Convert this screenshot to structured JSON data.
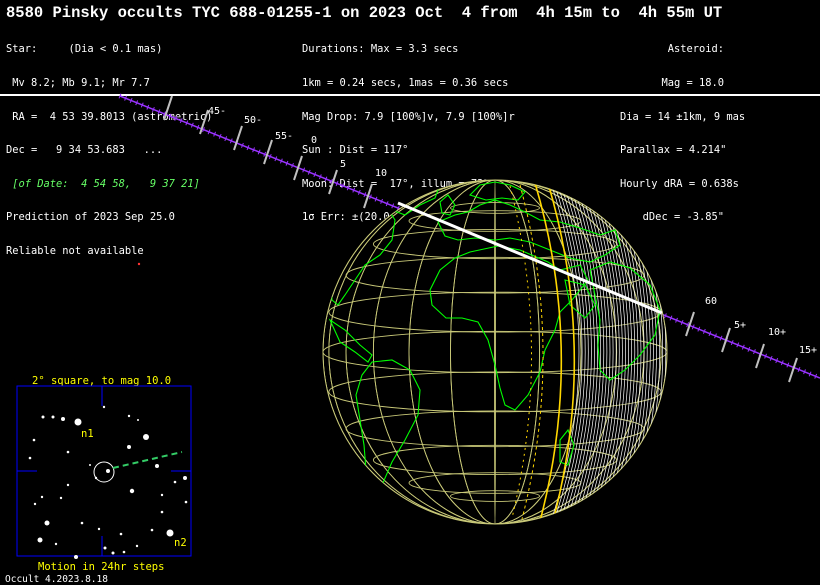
{
  "header": {
    "title": "8580 Pinsky occults TYC 688-01255-1 on 2023 Oct  4 from  4h 15m to  4h 55m UT"
  },
  "star_info": {
    "line1": "Star:     (Dia < 0.1 mas)",
    "line2": " Mv 8.2; Mb 9.1; Mr 7.7",
    "line3": " RA =  4 53 39.8013 (astrometric)",
    "line4": "Dec =   9 34 53.683   ...",
    "line5": " [of Date:  4 54 58,   9 37 21]",
    "line6": "Prediction of 2023 Sep 25.0",
    "line7": "Reliable not available"
  },
  "event_info": {
    "line1": "Durations: Max = 3.3 secs",
    "line2": "1km = 0.24 secs, 1mas = 0.36 secs",
    "line3": "Mag Drop: 7.9 [100%]v, 7.9 [100%]r",
    "line4": "Sun : Dist = 117°",
    "line5": "Moon: Dist =  17°, illum = 73%",
    "line6": "1σ Err: ±(20.0 x 2.0) mas in PA 74°"
  },
  "asteroid_info": {
    "line1": "Asteroid:",
    "line2": "Mag = 18.0",
    "line3": "Dia = 14 ±1km, 9 mas",
    "line4": "Parallax = 4.214\"",
    "line5": "Hourly dRA = 0.638s",
    "line6": "dDec = -3.85\""
  },
  "track_ticks_left": [
    "45-",
    "50-",
    "55-",
    "0",
    "5",
    "10"
  ],
  "track_ticks_right": [
    "60",
    "5+",
    "10+",
    "15+"
  ],
  "star_chart": {
    "title": "2° square, to mag 10.0",
    "footer": "Motion in 24hr steps",
    "label_n1": "n1",
    "label_n2": "n2"
  },
  "colors": {
    "background": "#000000",
    "graticule": "#c8c878",
    "coastline": "#00ff00",
    "shadow_edge": "#ffd700",
    "path": "#ffffff",
    "track": "#9933ff",
    "chart_frame": "#0000ff",
    "chart_text": "#ffff00",
    "motion": "#33cc66"
  },
  "footer": {
    "version": "Occult 4.2023.8.18"
  }
}
